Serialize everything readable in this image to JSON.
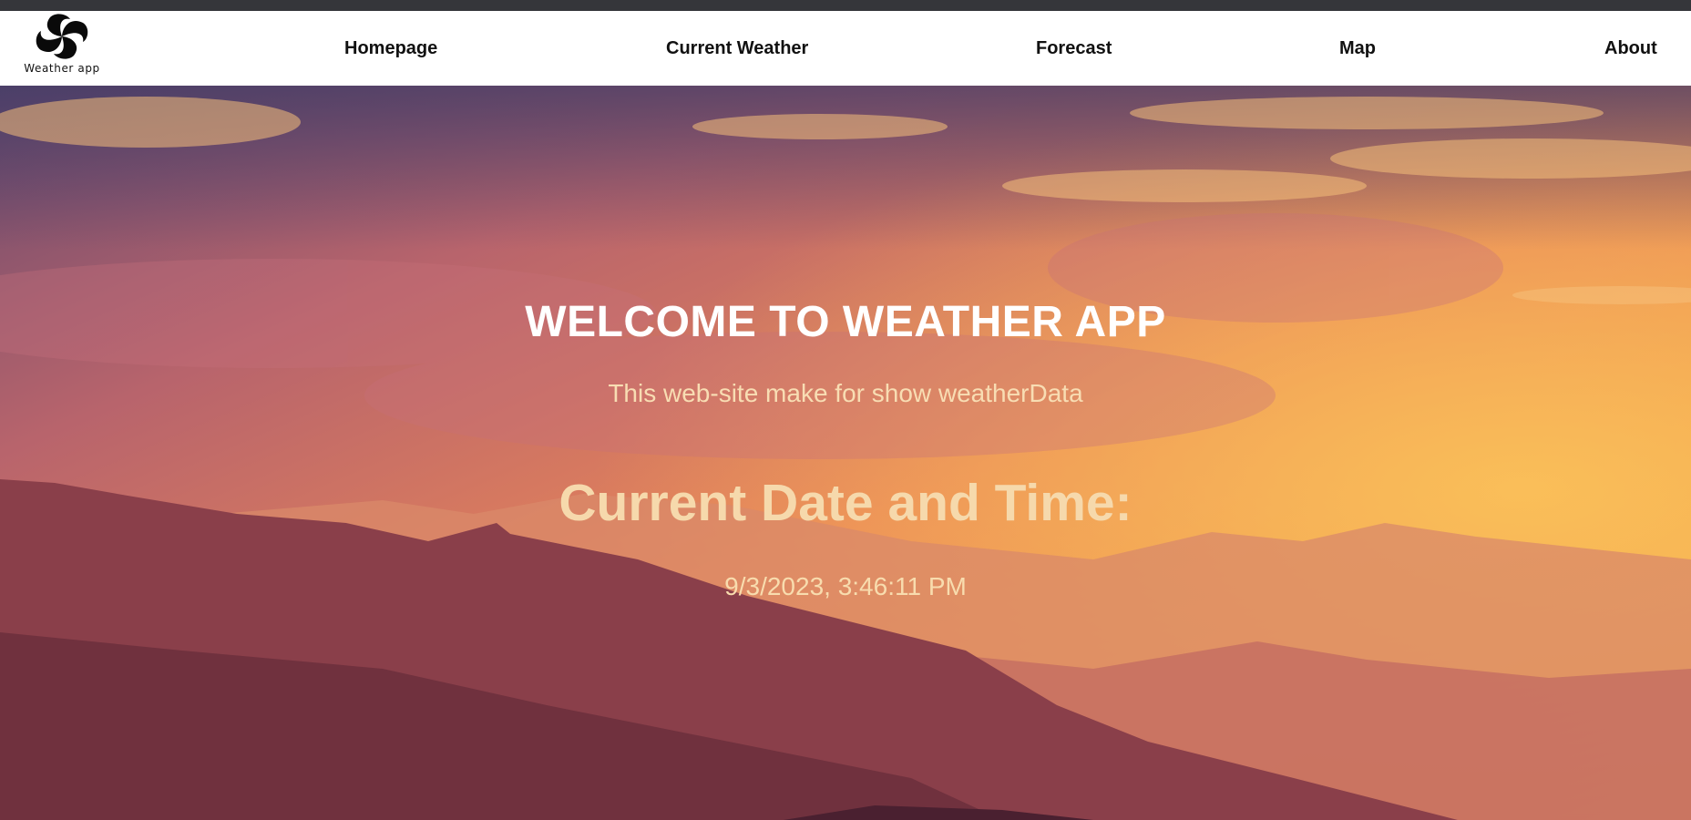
{
  "logo": {
    "text": "Weather app",
    "icon": "swirl-logo-icon"
  },
  "nav": {
    "items": [
      {
        "label": "Homepage"
      },
      {
        "label": "Current Weather"
      },
      {
        "label": "Forecast"
      },
      {
        "label": "Map"
      },
      {
        "label": "About"
      }
    ]
  },
  "hero": {
    "title": "WELCOME TO WEATHER APP",
    "subtitle": "This web-site make for show weatherData",
    "datetime_heading": "Current Date and Time:",
    "datetime_value": "9/3/2023, 3:46:11 PM",
    "background": "sunset-mountains-image"
  },
  "colors": {
    "navbar_bg": "#ffffff",
    "title": "#ffffff",
    "accent_text": "#f6d9ac"
  }
}
